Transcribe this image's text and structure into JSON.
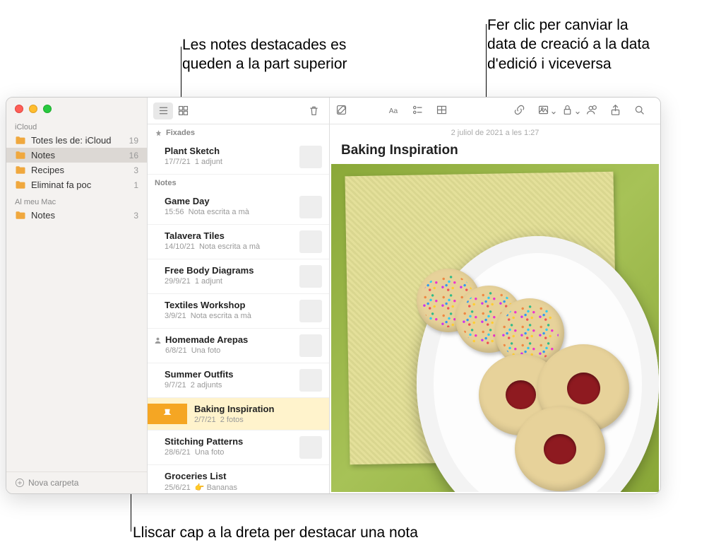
{
  "callouts": {
    "pinned": "Les notes destacades es\nqueden a la part superior",
    "date": "Fer clic per canviar la\ndata de creació a la data\nd'edició i viceversa",
    "swipe": "Lliscar cap a la dreta per destacar una nota"
  },
  "sidebar": {
    "sections": [
      {
        "label": "iCloud",
        "folders": [
          {
            "name": "Totes les de: iCloud",
            "count": 19
          },
          {
            "name": "Notes",
            "count": 16,
            "selected": true
          },
          {
            "name": "Recipes",
            "count": 3
          },
          {
            "name": "Eliminat fa poc",
            "count": 1
          }
        ]
      },
      {
        "label": "Al meu Mac",
        "folders": [
          {
            "name": "Notes",
            "count": 3
          }
        ]
      }
    ],
    "newFolder": "Nova carpeta"
  },
  "noteList": {
    "pinnedHeader": "Fixades",
    "notesHeader": "Notes",
    "pinned": [
      {
        "title": "Plant Sketch",
        "date": "17/7/21",
        "snippet": "1 adjunt",
        "thumb": "th-plant"
      }
    ],
    "items": [
      {
        "title": "Game Day",
        "date": "15:56",
        "snippet": "Nota escrita a mà",
        "thumb": "th-game"
      },
      {
        "title": "Talavera Tiles",
        "date": "14/10/21",
        "snippet": "Nota escrita a mà",
        "thumb": "th-tiles"
      },
      {
        "title": "Free Body Diagrams",
        "date": "29/9/21",
        "snippet": "1 adjunt",
        "thumb": "th-body"
      },
      {
        "title": "Textiles Workshop",
        "date": "3/9/21",
        "snippet": "Nota escrita a mà",
        "thumb": "th-text"
      },
      {
        "title": "Homemade Arepas",
        "date": "6/8/21",
        "snippet": "Una foto",
        "thumb": "th-arepa",
        "shared": true
      },
      {
        "title": "Summer Outfits",
        "date": "9/7/21",
        "snippet": "2 adjunts",
        "thumb": "th-summer"
      },
      {
        "title": "Baking Inspiration",
        "date": "2/7/21",
        "snippet": "2 fotos",
        "thumb": "",
        "selected": true,
        "swiped": true
      },
      {
        "title": "Stitching Patterns",
        "date": "28/6/21",
        "snippet": "Una foto",
        "thumb": "th-stitch"
      },
      {
        "title": "Groceries List",
        "date": "25/6/21",
        "snippet": "👉 Bananas",
        "thumb": ""
      }
    ]
  },
  "detail": {
    "dateLine": "2 juliol de 2021 a les 1:27",
    "title": "Baking Inspiration"
  }
}
